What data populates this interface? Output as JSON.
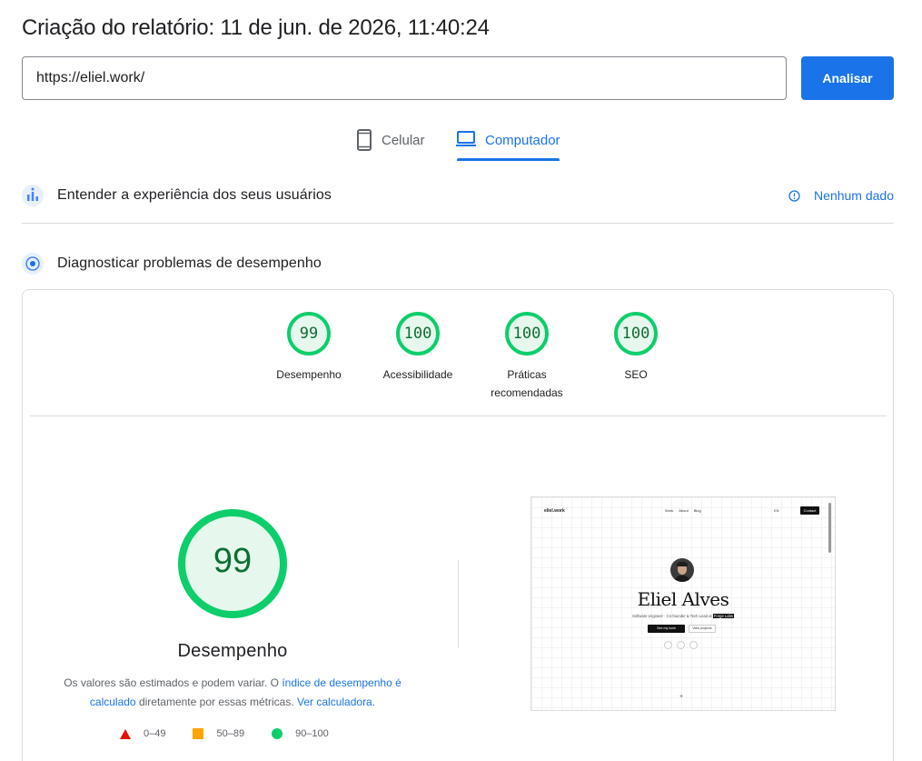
{
  "header": {
    "title": "Criação do relatório: 11 de jun. de 2026, 11:40:24"
  },
  "search": {
    "value": "https://eliel.work/",
    "button_label": "Analisar"
  },
  "tabs": [
    {
      "label": "Celular",
      "icon": "phone-icon",
      "active": false
    },
    {
      "label": "Computador",
      "icon": "laptop-icon",
      "active": true
    }
  ],
  "sections": {
    "ux": {
      "title": "Entender a experiência dos seus usuários",
      "status": "Nenhum dado"
    },
    "diag": {
      "title": "Diagnosticar problemas de desempenho"
    }
  },
  "scores": [
    {
      "label": "Desempenho",
      "value": "99",
      "fraction": 0.99
    },
    {
      "label": "Acessibilidade",
      "value": "100",
      "fraction": 1.0
    },
    {
      "label": "Práticas recomendadas",
      "value": "100",
      "fraction": 1.0
    },
    {
      "label": "SEO",
      "value": "100",
      "fraction": 1.0
    }
  ],
  "performance": {
    "score": "99",
    "label": "Desempenho",
    "desc_part1": "Os valores são estimados e podem variar. O ",
    "desc_link1": "índice de desempenho é calculado",
    "desc_part2": " diretamente por essas métricas. ",
    "desc_link2": "Ver calculadora."
  },
  "legend": [
    {
      "range": "0–49",
      "shape": "triangle",
      "color": "#eb0f00"
    },
    {
      "range": "50–89",
      "shape": "square",
      "color": "#ffa400"
    },
    {
      "range": "90–100",
      "shape": "circle",
      "color": "#0cce6b"
    }
  ],
  "colors": {
    "accent": "#1a73e8",
    "pass_ring": "#0cce6b",
    "pass_fill": "#e6f7ed",
    "pass_text": "#0c6f33"
  },
  "screenshot": {
    "logo": "eliel.work",
    "nav_links": [
      "Work",
      "About",
      "Blog"
    ],
    "lang": "EN",
    "contact": "Contact",
    "name": "Eliel Alves",
    "tagline": "Software engineer · Co-founder & Tech Lead at",
    "company": "Forge Labs",
    "btn_primary": "See my work",
    "btn_secondary": "View projects",
    "plus": "+"
  }
}
